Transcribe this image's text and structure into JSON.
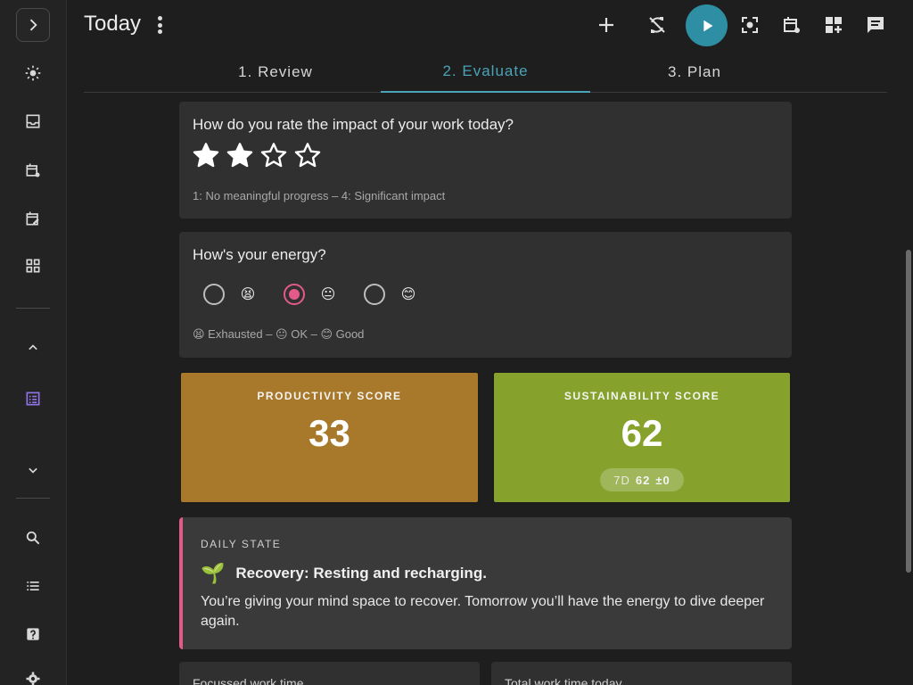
{
  "header": {
    "title": "Today"
  },
  "tabs": [
    {
      "label": "1. Review"
    },
    {
      "label": "2. Evaluate"
    },
    {
      "label": "3. Plan"
    }
  ],
  "impact": {
    "question": "How do you rate the impact of your work today?",
    "rating": 2,
    "max": 4,
    "hint": "1: No meaningful progress – 4: Significant impact"
  },
  "energy": {
    "question": "How's your energy?",
    "options": [
      {
        "emoji": "😫",
        "selected": false
      },
      {
        "emoji": "😐",
        "selected": true
      },
      {
        "emoji": "😊",
        "selected": false
      }
    ],
    "hint": "😫 Exhausted – 😐 OK – 😊 Good"
  },
  "productivity": {
    "label": "PRODUCTIVITY SCORE",
    "value": "33",
    "color": "#a8792b"
  },
  "sustainability": {
    "label": "SUSTAINABILITY SCORE",
    "value": "62",
    "color": "#86a22c",
    "trend_period": "7D",
    "trend_value": "62",
    "trend_delta": "±0"
  },
  "daily_state": {
    "caption": "DAILY STATE",
    "emoji": "🌱",
    "headline": "Recovery: Resting and recharging.",
    "body": "You’re giving your mind space to recover. Tomorrow you’ll have the energy to dive deeper again."
  },
  "bottom_cards": [
    {
      "label": "Focussed work time"
    },
    {
      "label": "Total work time today"
    }
  ],
  "colors": {
    "accent": "#4aa3b8",
    "play": "#2e8ea3",
    "pink": "#e35a8a",
    "sidebar_active": "#8f74e6"
  }
}
